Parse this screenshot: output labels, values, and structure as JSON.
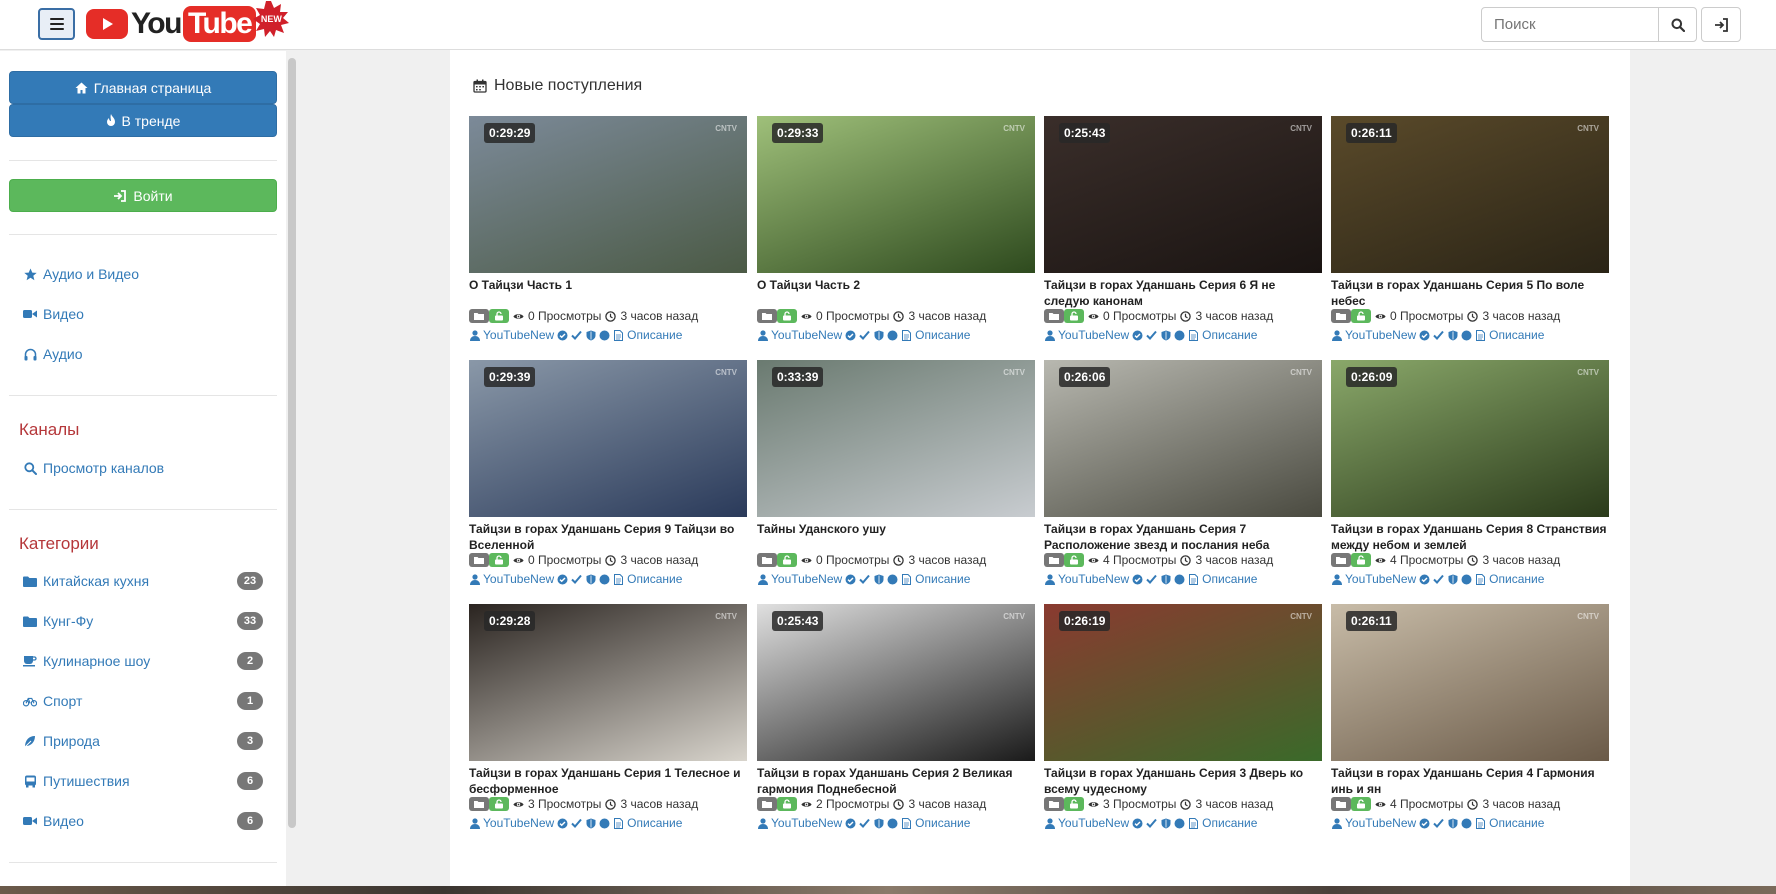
{
  "header": {
    "logo_you": "You",
    "logo_tube": "Tube",
    "logo_badge": "NEW",
    "search_placeholder": "Поиск"
  },
  "sidebar": {
    "home_label": "Главная страница",
    "trending_label": "В тренде",
    "login_label": "Войти",
    "links": [
      {
        "label": "Аудио и Видео",
        "icon": "star-icon"
      },
      {
        "label": "Видео",
        "icon": "video-camera-icon"
      },
      {
        "label": "Аудио",
        "icon": "headphones-icon"
      }
    ],
    "channels_heading": "Каналы",
    "browse_channels_label": "Просмотр каналов",
    "categories_heading": "Категории",
    "categories": [
      {
        "label": "Китайская кухня",
        "count": "23",
        "icon": "folder-icon"
      },
      {
        "label": "Кунг-Фу",
        "count": "33",
        "icon": "folder-icon"
      },
      {
        "label": "Кулинарное шоу",
        "count": "2",
        "icon": "coffee-cup-icon"
      },
      {
        "label": "Спорт",
        "count": "1",
        "icon": "bicycle-icon"
      },
      {
        "label": "Природа",
        "count": "3",
        "icon": "leaf-icon"
      },
      {
        "label": "Путишествия",
        "count": "6",
        "icon": "bus-icon"
      },
      {
        "label": "Видео",
        "count": "6",
        "icon": "video-camera-icon"
      }
    ]
  },
  "main": {
    "title": "Новые поступления",
    "videos": [
      {
        "duration": "0:29:29",
        "title": "О Тайцзи Часть 1",
        "views": "0 Просмотры",
        "time": "3 часов назад",
        "channel": "YouTubeNew",
        "desc": "Описание",
        "c1": "#7c8a99",
        "c2": "#4b5a45"
      },
      {
        "duration": "0:29:33",
        "title": "О Тайцзи Часть 2",
        "views": "0 Просмотры",
        "time": "3 часов назад",
        "channel": "YouTubeNew",
        "desc": "Описание",
        "c1": "#9fc07a",
        "c2": "#2e4a1e"
      },
      {
        "duration": "0:25:43",
        "title": "Тайцзи в горах Уданшань Серия 6 Я не следую канонам",
        "views": "0 Просмотры",
        "time": "3 часов назад",
        "channel": "YouTubeNew",
        "desc": "Описание",
        "c1": "#3a2e2a",
        "c2": "#1a1412"
      },
      {
        "duration": "0:26:11",
        "title": "Тайцзи в горах Уданшань Серия 5 По воле небес",
        "views": "0 Просмотры",
        "time": "3 часов назад",
        "channel": "YouTubeNew",
        "desc": "Описание",
        "c1": "#5a4a2a",
        "c2": "#2a2416"
      },
      {
        "duration": "0:29:39",
        "title": "Тайцзи в горах Уданшань Серия 9 Тайцзи во Вселенной",
        "views": "0 Просмотры",
        "time": "3 часов назад",
        "channel": "YouTubeNew",
        "desc": "Описание",
        "c1": "#8a98a8",
        "c2": "#2a3a5a"
      },
      {
        "duration": "0:33:39",
        "title": "Тайны Уданского ушу",
        "views": "0 Просмотры",
        "time": "3 часов назад",
        "channel": "YouTubeNew",
        "desc": "Описание",
        "c1": "#6a7a70",
        "c2": "#c8ccd0"
      },
      {
        "duration": "0:26:06",
        "title": "Тайцзи в горах Уданшань Серия 7 Расположение звезд и послания неба",
        "views": "4 Просмотры",
        "time": "3 часов назад",
        "channel": "YouTubeNew",
        "desc": "Описание",
        "c1": "#b8b8b0",
        "c2": "#4a4a40"
      },
      {
        "duration": "0:26:09",
        "title": "Тайцзи в горах Уданшань Серия 8 Странствия между небом и землей",
        "views": "4 Просмотры",
        "time": "3 часов назад",
        "channel": "YouTubeNew",
        "desc": "Описание",
        "c1": "#8aa86a",
        "c2": "#2a3a1a"
      },
      {
        "duration": "0:29:28",
        "title": "Тайцзи в горах Уданшань Серия 1 Телесное и бесформенное",
        "views": "3 Просмотры",
        "time": "3 часов назад",
        "channel": "YouTubeNew",
        "desc": "Описание",
        "c1": "#2a2420",
        "c2": "#d8d4cc"
      },
      {
        "duration": "0:25:43",
        "title": "Тайцзи в горах Уданшань Серия 2 Великая гармония Поднебесной",
        "views": "2 Просмотры",
        "time": "3 часов назад",
        "channel": "YouTubeNew",
        "desc": "Описание",
        "c1": "#e0e0e0",
        "c2": "#1a1a1a"
      },
      {
        "duration": "0:26:19",
        "title": "Тайцзи в горах Уданшань Серия 3 Дверь ко всему чудесному",
        "views": "3 Просмотры",
        "time": "3 часов назад",
        "channel": "YouTubeNew",
        "desc": "Описание",
        "c1": "#8a3a30",
        "c2": "#3a6a2a"
      },
      {
        "duration": "0:26:11",
        "title": "Тайцзи в горах Уданшань Серия 4 Гармония инь и ян",
        "views": "4 Просмотры",
        "time": "3 часов назад",
        "channel": "YouTubeNew",
        "desc": "Описание",
        "c1": "#c8bca8",
        "c2": "#6a5a48"
      }
    ]
  }
}
